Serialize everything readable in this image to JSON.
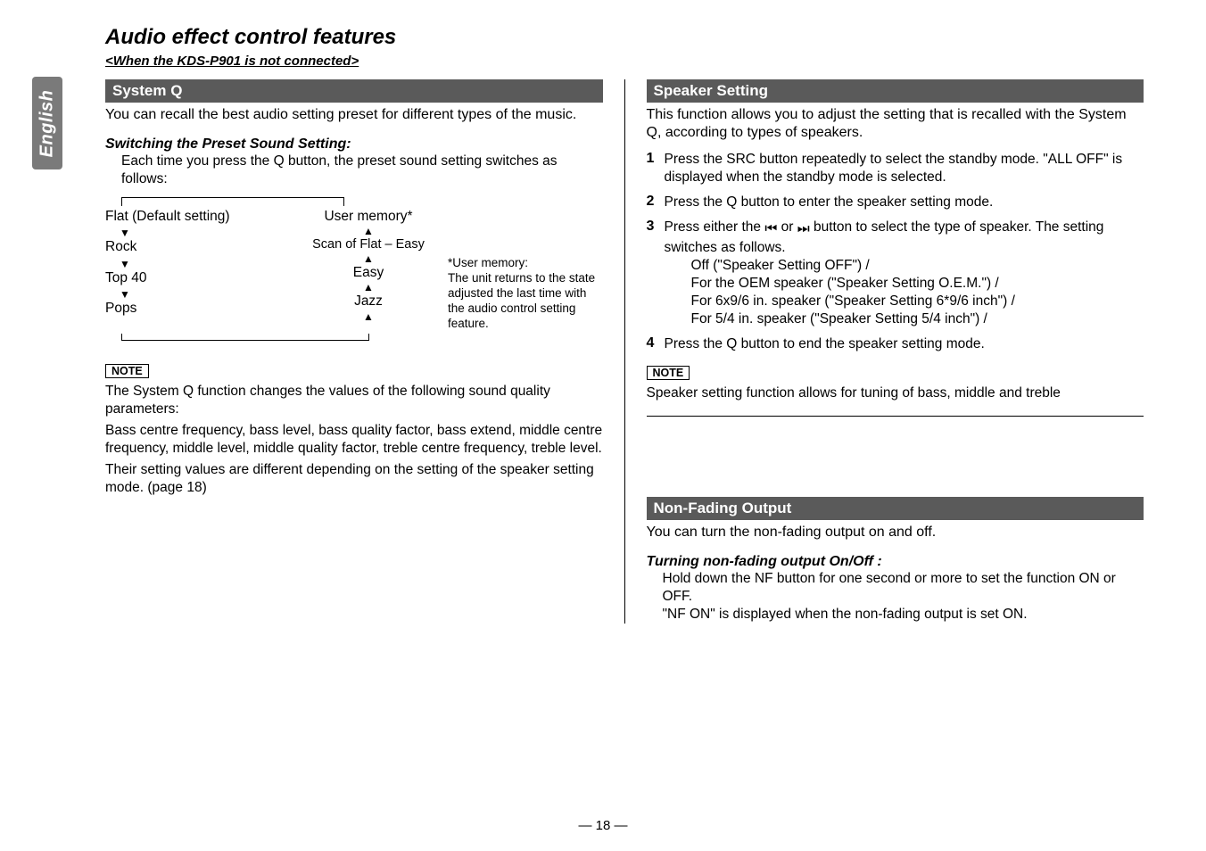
{
  "sideTab": "English",
  "title": "Audio effect control features",
  "subtitle": "<When the KDS-P901 is not connected>",
  "left": {
    "sectionBar": "System Q",
    "lead": "You can recall the best audio setting preset for different types of the music.",
    "switchHead": "Switching the Preset Sound Setting:",
    "switchBody": "Each time you press the Q button, the preset sound setting switches as follows:",
    "presets": {
      "flat": "Flat (Default setting)",
      "rock": "Rock",
      "top40": "Top 40",
      "pops": "Pops",
      "userMem": "User memory*",
      "scan": "Scan of Flat – Easy",
      "easy": "Easy",
      "jazz": "Jazz",
      "noteTitle": "*User memory:",
      "noteBody": "The unit returns to the state adjusted the last time with the audio control setting feature."
    },
    "noteLabel": "NOTE",
    "note1": "The System Q function changes the values of the following sound quality parameters:",
    "note2": "Bass centre frequency, bass level, bass quality factor, bass extend, middle centre frequency, middle level, middle quality factor, treble centre frequency, treble level.",
    "note3": "Their setting values are different depending on the setting of the speaker setting mode. (page 18)"
  },
  "right": {
    "speakerBar": "Speaker Setting",
    "speakerLead": "This function allows you to adjust the setting that is recalled with the System Q, according to types of speakers.",
    "step1": "Press the SRC button repeatedly to select the standby mode. \"ALL OFF\" is displayed when the standby mode is selected.",
    "step2": "Press the Q button to enter the speaker setting mode.",
    "step3a": "Press either the ",
    "step3b": " or ",
    "step3c": " button to select the type of speaker. The setting switches as follows.",
    "step3opts": [
      "Off (\"Speaker Setting OFF\") /",
      "For the OEM speaker (\"Speaker Setting O.E.M.\") /",
      "For 6x9/6 in. speaker (\"Speaker Setting 6*9/6 inch\") /",
      "For 5/4 in. speaker (\"Speaker Setting 5/4 inch\") /"
    ],
    "step4": "Press the Q button to end the speaker setting mode.",
    "noteLabel": "NOTE",
    "noteText": "Speaker setting function allows for tuning of bass, middle and treble",
    "nfBar": "Non-Fading Output",
    "nfLead": "You can turn the non-fading output on and off.",
    "nfHead": "Turning non-fading output On/Off :",
    "nfBody1": "Hold down the NF button for one second or more to set the function ON or OFF.",
    "nfBody2": "\"NF ON\" is displayed when the non-fading output is set ON."
  },
  "footer": "— 18 —",
  "stepNums": {
    "s1": "1",
    "s2": "2",
    "s3": "3",
    "s4": "4"
  }
}
